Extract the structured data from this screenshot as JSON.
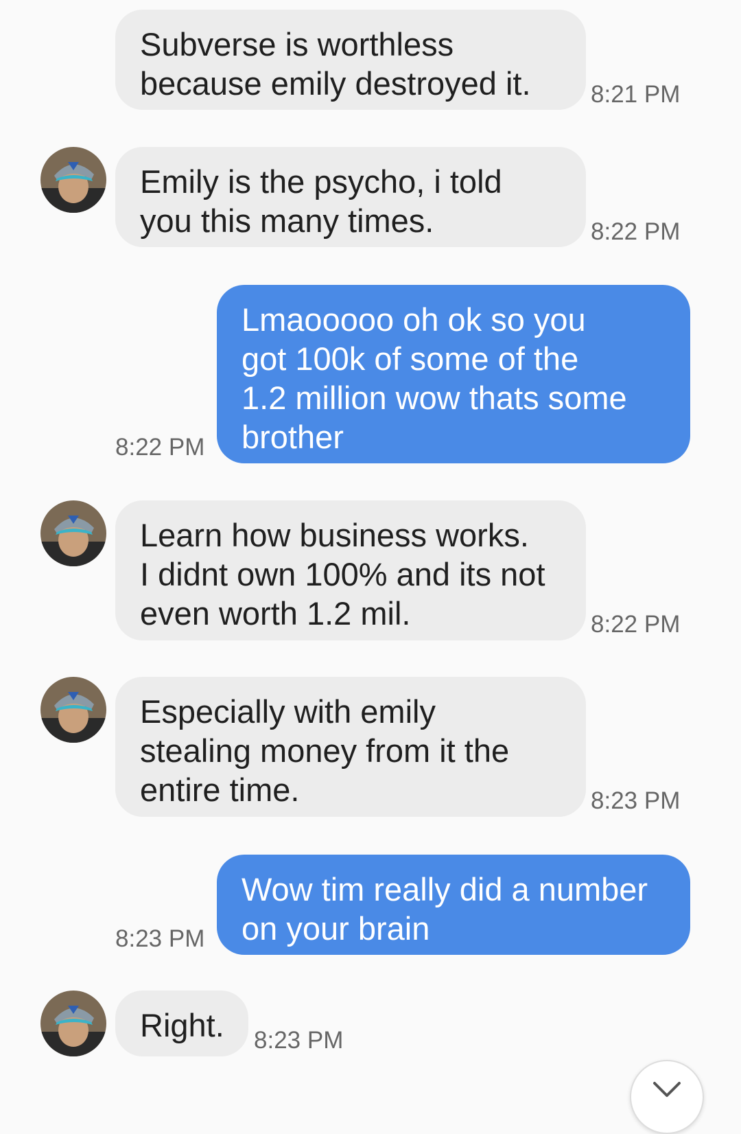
{
  "messages": [
    {
      "direction": "incoming",
      "avatar": false,
      "text": "Subverse is worthless\nbecause emily destroyed it.",
      "time": "8:21 PM"
    },
    {
      "direction": "incoming",
      "avatar": true,
      "text": "Emily is the psycho, i told\nyou this many times.",
      "time": "8:22 PM"
    },
    {
      "direction": "outgoing",
      "text": "Lmaooooo oh ok so you\ngot 100k of some of the\n1.2 million wow thats some\nbrother",
      "time": "8:22 PM"
    },
    {
      "direction": "incoming",
      "avatar": true,
      "text": "Learn how business works.\nI didnt own 100% and its not\neven worth 1.2 mil.",
      "time": "8:22 PM"
    },
    {
      "direction": "incoming",
      "avatar": true,
      "text": "Especially with emily\nstealing money from it the\nentire time.",
      "time": "8:23 PM"
    },
    {
      "direction": "outgoing",
      "text": "Wow tim really did a number\non your brain",
      "time": "8:23 PM"
    },
    {
      "direction": "incoming",
      "avatar": true,
      "text": "Right.",
      "time": "8:23 PM"
    }
  ],
  "icons": {
    "avatar": "contact-avatar-icon",
    "scroll_down": "chevron-down-icon"
  },
  "colors": {
    "incoming_bubble": "#ececec",
    "outgoing_bubble": "#4a8ae6",
    "background": "#fafafa"
  }
}
